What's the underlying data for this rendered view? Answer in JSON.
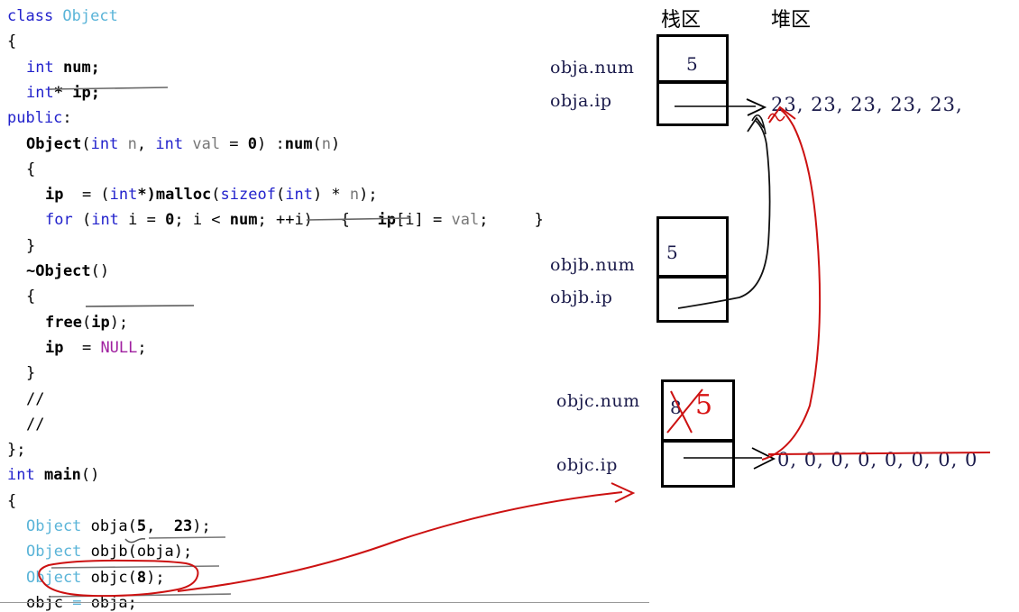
{
  "code": {
    "language": "cpp",
    "lines": [
      {
        "indent": 0,
        "tokens": [
          {
            "t": "class ",
            "c": "kw"
          },
          {
            "t": "Object",
            "c": "typ"
          }
        ]
      },
      {
        "indent": 0,
        "tokens": [
          {
            "t": "{",
            "c": "plain"
          }
        ]
      },
      {
        "indent": 1,
        "tokens": [
          {
            "t": "int",
            "c": "kw"
          },
          {
            "t": " ",
            "c": "plain"
          },
          {
            "t": "num;",
            "c": "bld"
          }
        ]
      },
      {
        "indent": 1,
        "tokens": [
          {
            "t": "int",
            "c": "kw"
          },
          {
            "t": "*",
            "c": "bld"
          },
          {
            "t": " ",
            "c": "plain"
          },
          {
            "t": "ip;",
            "c": "bld"
          }
        ]
      },
      {
        "indent": 0,
        "tokens": [
          {
            "t": "public",
            "c": "kw"
          },
          {
            "t": ":",
            "c": "plain"
          }
        ]
      },
      {
        "indent": 1,
        "tokens": [
          {
            "t": "Object",
            "c": "bld"
          },
          {
            "t": "(",
            "c": "plain"
          },
          {
            "t": "int",
            "c": "kw"
          },
          {
            "t": " ",
            "c": "plain"
          },
          {
            "t": "n",
            "c": "dim"
          },
          {
            "t": ", ",
            "c": "plain"
          },
          {
            "t": "int",
            "c": "kw"
          },
          {
            "t": " ",
            "c": "plain"
          },
          {
            "t": "val",
            "c": "dim"
          },
          {
            "t": " = ",
            "c": "plain"
          },
          {
            "t": "0",
            "c": "num"
          },
          {
            "t": ") :",
            "c": "plain"
          },
          {
            "t": "num",
            "c": "bld"
          },
          {
            "t": "(",
            "c": "plain"
          },
          {
            "t": "n",
            "c": "dim"
          },
          {
            "t": ")",
            "c": "plain"
          }
        ]
      },
      {
        "indent": 1,
        "tokens": [
          {
            "t": "{",
            "c": "plain"
          }
        ]
      },
      {
        "indent": 2,
        "tokens": [
          {
            "t": "ip",
            "c": "bld"
          },
          {
            "t": "  = (",
            "c": "plain"
          },
          {
            "t": "int",
            "c": "kw"
          },
          {
            "t": "*)",
            "c": "bld"
          },
          {
            "t": "malloc",
            "c": "bld"
          },
          {
            "t": "(",
            "c": "plain"
          },
          {
            "t": "sizeof",
            "c": "kw"
          },
          {
            "t": "(",
            "c": "plain"
          },
          {
            "t": "int",
            "c": "kw"
          },
          {
            "t": ") * ",
            "c": "plain"
          },
          {
            "t": "n",
            "c": "dim"
          },
          {
            "t": ");",
            "c": "plain"
          }
        ]
      },
      {
        "indent": 2,
        "tokens": [
          {
            "t": "for",
            "c": "kw"
          },
          {
            "t": " (",
            "c": "plain"
          },
          {
            "t": "int",
            "c": "kw"
          },
          {
            "t": " i = ",
            "c": "plain"
          },
          {
            "t": "0",
            "c": "num"
          },
          {
            "t": "; i < ",
            "c": "plain"
          },
          {
            "t": "num",
            "c": "bld"
          },
          {
            "t": "; ++i)   {   ",
            "c": "plain"
          },
          {
            "t": "ip",
            "c": "bld"
          },
          {
            "t": "[i] = ",
            "c": "plain"
          },
          {
            "t": "val",
            "c": "dim"
          },
          {
            "t": ";     }",
            "c": "plain"
          }
        ]
      },
      {
        "indent": 1,
        "tokens": [
          {
            "t": "}",
            "c": "plain"
          }
        ]
      },
      {
        "indent": 1,
        "tokens": [
          {
            "t": "~Object",
            "c": "bld"
          },
          {
            "t": "()",
            "c": "plain"
          }
        ]
      },
      {
        "indent": 1,
        "tokens": [
          {
            "t": "{",
            "c": "plain"
          }
        ]
      },
      {
        "indent": 2,
        "tokens": [
          {
            "t": "free",
            "c": "bld"
          },
          {
            "t": "(",
            "c": "plain"
          },
          {
            "t": "ip",
            "c": "bld"
          },
          {
            "t": ");",
            "c": "plain"
          }
        ]
      },
      {
        "indent": 2,
        "tokens": [
          {
            "t": "ip",
            "c": "bld"
          },
          {
            "t": "  = ",
            "c": "plain"
          },
          {
            "t": "NULL",
            "c": "null"
          },
          {
            "t": ";",
            "c": "plain"
          }
        ]
      },
      {
        "indent": 1,
        "tokens": [
          {
            "t": "}",
            "c": "plain"
          }
        ]
      },
      {
        "indent": 1,
        "tokens": [
          {
            "t": "//",
            "c": "plain"
          }
        ]
      },
      {
        "indent": 1,
        "tokens": [
          {
            "t": "//",
            "c": "plain"
          }
        ]
      },
      {
        "indent": 0,
        "tokens": [
          {
            "t": "};",
            "c": "plain"
          }
        ]
      },
      {
        "indent": 0,
        "tokens": [
          {
            "t": "int",
            "c": "kw"
          },
          {
            "t": " ",
            "c": "plain"
          },
          {
            "t": "main",
            "c": "bld"
          },
          {
            "t": "()",
            "c": "plain"
          }
        ]
      },
      {
        "indent": 0,
        "tokens": [
          {
            "t": "{",
            "c": "plain"
          }
        ]
      },
      {
        "indent": 1,
        "tokens": [
          {
            "t": "Object",
            "c": "typ"
          },
          {
            "t": " obja(",
            "c": "plain"
          },
          {
            "t": "5",
            "c": "num"
          },
          {
            "t": ",  ",
            "c": "plain"
          },
          {
            "t": "23",
            "c": "num"
          },
          {
            "t": ");",
            "c": "plain"
          }
        ]
      },
      {
        "indent": 1,
        "tokens": [
          {
            "t": "Object",
            "c": "typ"
          },
          {
            "t": " objb(obja);",
            "c": "plain"
          }
        ]
      },
      {
        "indent": 1,
        "tokens": [
          {
            "t": "Object",
            "c": "typ"
          },
          {
            "t": " objc(",
            "c": "plain"
          },
          {
            "t": "8",
            "c": "num"
          },
          {
            "t": ");",
            "c": "plain"
          }
        ]
      },
      {
        "indent": 1,
        "tokens": [
          {
            "t": "objc",
            "c": "plain"
          },
          {
            "t": " ",
            "c": "plain"
          },
          {
            "t": "=",
            "c": "typ"
          },
          {
            "t": " obja;",
            "c": "plain"
          }
        ]
      }
    ]
  },
  "diagram": {
    "zones": {
      "stack_label": "栈区",
      "heap_label": "堆区"
    },
    "objects": [
      {
        "id": "obja",
        "num_label": "obja.num",
        "num_value": "5",
        "ip_label": "obja.ip",
        "heap_value": "23, 23, 23, 23, 23,"
      },
      {
        "id": "objb",
        "num_label": "objb.num",
        "num_value": "5",
        "ip_label": "objb.ip",
        "heap_value": ""
      },
      {
        "id": "objc",
        "num_label": "objc.num",
        "num_value": "8",
        "num_value_corrected": "5",
        "ip_label": "objc.ip",
        "heap_value": "0, 0, 0, 0, 0, 0, 0, 0"
      }
    ]
  },
  "colors": {
    "keyword": "#2222cc",
    "type": "#5ab4d8",
    "null": "#a020a0",
    "ink_red": "#d81414",
    "ink_black": "#000000",
    "value_text": "#1b1b4b"
  }
}
